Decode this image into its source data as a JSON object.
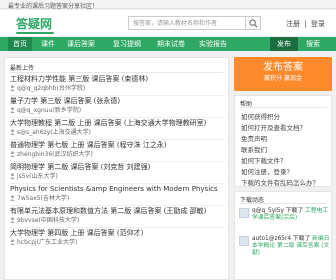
{
  "topbar": {
    "slogan": "最专业的课后习题答案分享社区！"
  },
  "header": {
    "logo": "答疑网",
    "search_placeholder": "搜答案，请输入教材名称和作者",
    "register": "注册",
    "divider": "|",
    "login": "登录"
  },
  "nav": {
    "items": [
      "首页",
      "课件",
      "课后答案",
      "复习提纲",
      "期末试卷",
      "实验报告"
    ],
    "publish": "发布",
    "search": "搜索"
  },
  "list": {
    "heading": "最新上传",
    "items": [
      {
        "title": "工程材料力学性能 第三版 课后答案 (束德林)",
        "user": "q@q_q2qbhb(台州学院)"
      },
      {
        "title": "量子力学 第三版 课后答案 (张永德)",
        "user": "q@q_xgnuu(新乡学院)"
      },
      {
        "title": "大学物理教程 第二版 上册 课后答案 (上海交通大学物理教研室)",
        "user": "s@s_ah6zy(上海交通大学)"
      },
      {
        "title": "普通物理学 第七版 上册 课后答案 (程守洙 江之永)",
        "user": "zhengbin36(武汉纺织大学)"
      },
      {
        "title": "简明物理学 第二版 课后答案 (刘克哲 刘建强)",
        "user": "js5v(山东大学)"
      },
      {
        "title": "Physics for Scientists &amp Engineers with Modern Physics",
        "user": "7w5ax5(吉林大学)"
      },
      {
        "title": "有限单元法基本原理和数值方法 第二版 课后答案 (王勖成 邵敏)",
        "user": "9bvvse(中国科技大学)"
      },
      {
        "title": "大学物理学 第四版 上册 课后答案 (范仰才)",
        "user": "hcbcpj(广东工业大学)"
      }
    ]
  },
  "publish_box": {
    "title": "发布答案",
    "subtitle": "赢积分 赢现金"
  },
  "help": {
    "heading": "帮助",
    "links": [
      "如何获得积分",
      "如何打开及查看文档？",
      "免责声明",
      "联系我们",
      "如何下载文件？",
      "如何注册，登录？",
      "下载的文件有乱码怎么办？"
    ]
  },
  "downloads": {
    "heading": "下载动态",
    "items": [
      {
        "user": "q@q_5yi5y",
        "verb": "下载了",
        "title": "工程电工学课后答案(宗后)"
      },
      {
        "user": "auto1@z65r4",
        "verb": "下载了",
        "title": "新编日本学概论 第二版 课后答案 (文献)"
      }
    ]
  }
}
